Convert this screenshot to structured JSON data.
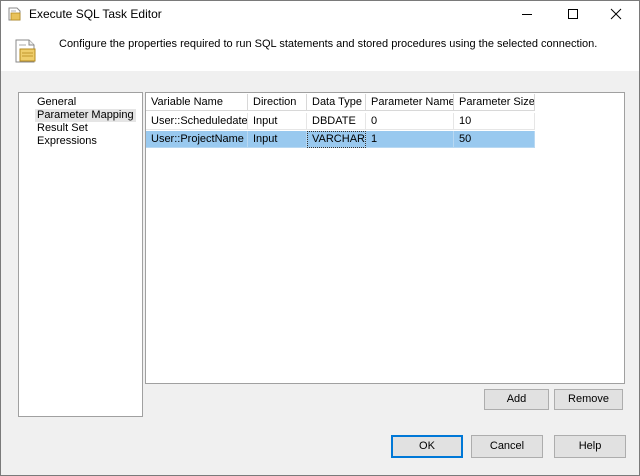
{
  "window": {
    "title": "Execute SQL Task Editor"
  },
  "header": {
    "description": "Configure the properties required to run SQL statements and stored procedures using the selected connection."
  },
  "nav": {
    "items": [
      "General",
      "Parameter Mapping",
      "Result Set",
      "Expressions"
    ],
    "selected": "Parameter Mapping"
  },
  "grid": {
    "columns": [
      "Variable Name",
      "Direction",
      "Data Type",
      "Parameter Name",
      "Parameter Size"
    ],
    "rows": [
      [
        "User::Scheduledate",
        "Input",
        "DBDATE",
        "0",
        "10"
      ],
      [
        "User::ProjectName",
        "Input",
        "VARCHAR",
        "1",
        "50"
      ]
    ],
    "selected_row": 2
  },
  "buttons": {
    "add": "Add",
    "remove": "Remove",
    "ok": "OK",
    "cancel": "Cancel",
    "help": "Help"
  },
  "icons": {
    "app": "sql-task-icon",
    "header": "sql-document-icon"
  },
  "colors": {
    "selection": "#99c9ef",
    "default_button_border": "#0078d7"
  }
}
